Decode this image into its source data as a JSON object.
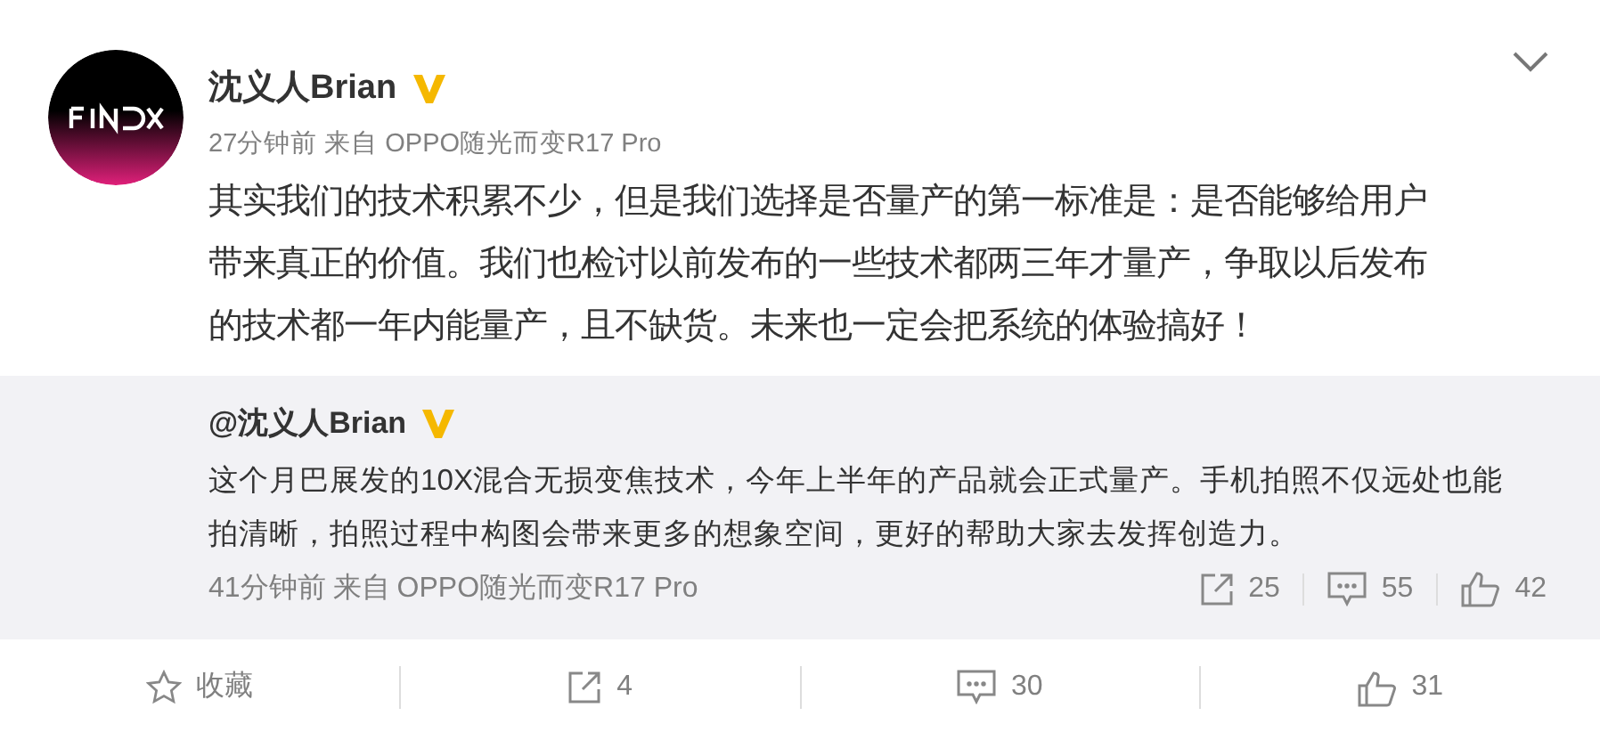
{
  "post": {
    "author": "沈义人Brian",
    "verified": true,
    "time": "27分钟前",
    "source_prefix": "来自",
    "source": "OPPO随光而变R17 Pro",
    "text": "其实我们的技术积累不少，但是我们选择是否量产的第一标准是：是否能够给用户带来真正的价值。我们也检讨以前发布的一些技术都两三年才量产，争取以后发布的技术都一年内能量产，且不缺货。未来也一定会把系统的体验搞好！"
  },
  "repost": {
    "author": "@沈义人Brian",
    "verified": true,
    "text": "这个月巴展发的10X混合无损变焦技术，今年上半年的产品就会正式量产。手机拍照不仅远处也能拍清晰，拍照过程中构图会带来更多的想象空间，更好的帮助大家去发挥创造力。",
    "time": "41分钟前",
    "source_prefix": "来自",
    "source": "OPPO随光而变R17 Pro",
    "actions": [
      {
        "kind": "share",
        "count": "25"
      },
      {
        "kind": "comment",
        "count": "55"
      },
      {
        "kind": "like",
        "count": "42"
      }
    ]
  },
  "actions": [
    {
      "kind": "favorite",
      "label": "收藏"
    },
    {
      "kind": "share",
      "label": "4"
    },
    {
      "kind": "comment",
      "label": "30"
    },
    {
      "kind": "like",
      "label": "31"
    }
  ]
}
